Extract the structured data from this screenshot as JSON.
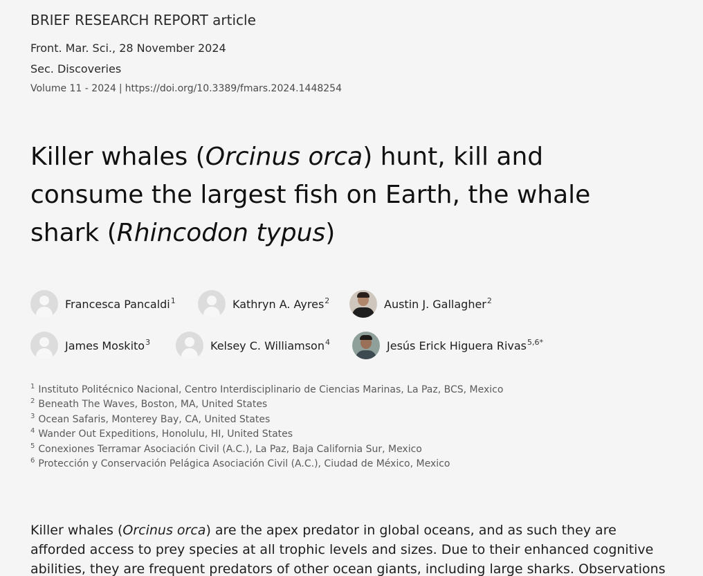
{
  "header": {
    "article_type": "BRIEF RESEARCH REPORT article",
    "journal_date": "Front. Mar. Sci., 28 November 2024",
    "section": "Sec. Discoveries",
    "volume": "Volume 11 - 2024",
    "separator": "|",
    "doi": "https://doi.org/10.3389/fmars.2024.1448254"
  },
  "title": {
    "part1": "Killer whales (",
    "italic1": "Orcinus orca",
    "part2": ") hunt, kill and consume the largest fish on Earth, the whale shark (",
    "italic2": "Rhincodon typus",
    "part3": ")"
  },
  "authors": [
    {
      "name": "Francesca Pancaldi",
      "sup": "1",
      "avatar": "placeholder"
    },
    {
      "name": "Kathryn A. Ayres",
      "sup": "2",
      "avatar": "placeholder"
    },
    {
      "name": "Austin J. Gallagher",
      "sup": "2",
      "avatar": "photo"
    },
    {
      "name": "James Moskito",
      "sup": "3",
      "avatar": "placeholder"
    },
    {
      "name": "Kelsey C. Williamson",
      "sup": "4",
      "avatar": "placeholder"
    },
    {
      "name": "Jesús Erick Higuera Rivas",
      "sup": "5,6*",
      "avatar": "photo"
    }
  ],
  "affiliations": [
    {
      "num": "1",
      "text": "Instituto Politécnico Nacional, Centro Interdisciplinario de Ciencias Marinas, La Paz, BCS, Mexico"
    },
    {
      "num": "2",
      "text": "Beneath The Waves, Boston, MA, United States"
    },
    {
      "num": "3",
      "text": "Ocean Safaris, Monterey Bay, CA, United States"
    },
    {
      "num": "4",
      "text": "Wander Out Expeditions, Honolulu, HI, United States"
    },
    {
      "num": "5",
      "text": "Conexiones Terramar Asociación Civil (A.C.), La Paz, Baja California Sur, Mexico"
    },
    {
      "num": "6",
      "text": "Protección y Conservación Pelágica Asociación Civil (A.C.), Ciudad de México, Mexico"
    }
  ],
  "abstract": {
    "part1": "Killer whales (",
    "italic1": "Orcinus orca",
    "part2": ") are the apex predator in global oceans, and as such they are afforded access to prey species at all trophic levels and sizes. Due to their enhanced cognitive abilities, they are frequent predators of other ocean giants, including large sharks. Observations of these"
  },
  "colors": {
    "background": "#f5f5f5",
    "text": "#1d1d1d",
    "muted": "#5a5a5a",
    "avatar_placeholder": "#dcdcdc"
  }
}
